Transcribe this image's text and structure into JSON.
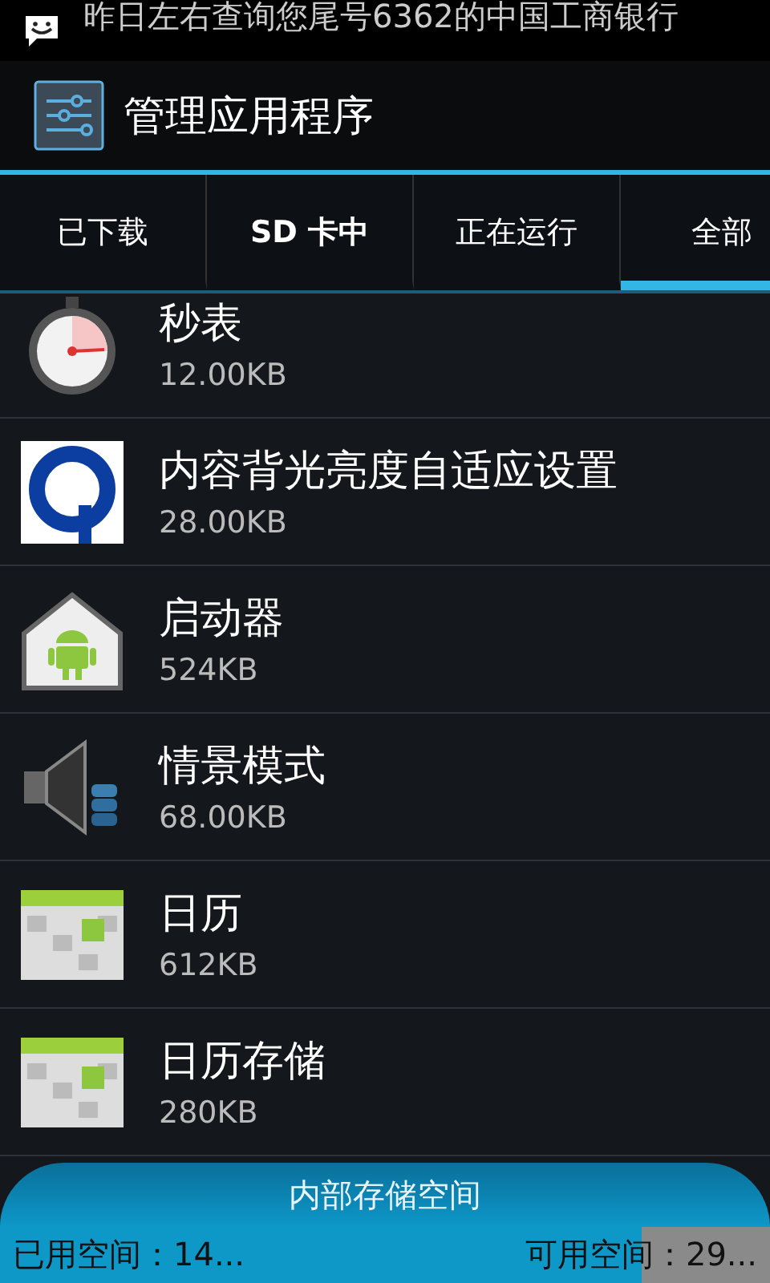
{
  "notification": {
    "text": "昨日左右查询您尾号6362的中国工商银行"
  },
  "app_bar": {
    "title": "管理应用程序"
  },
  "tabs": [
    {
      "label": "已下载",
      "selected": false
    },
    {
      "label": "SD 卡中",
      "selected": false
    },
    {
      "label": "正在运行",
      "selected": false
    },
    {
      "label": "全部",
      "selected": true
    }
  ],
  "apps": [
    {
      "name": "秒表",
      "size": "12.00KB"
    },
    {
      "name": "内容背光亮度自适应设置",
      "size": "28.00KB"
    },
    {
      "name": "启动器",
      "size": "524KB"
    },
    {
      "name": "情景模式",
      "size": "68.00KB"
    },
    {
      "name": "日历",
      "size": "612KB"
    },
    {
      "name": "日历存储",
      "size": "280KB"
    }
  ],
  "storage": {
    "title": "内部存储空间",
    "used": "已用空间：14...",
    "free": "可用空间：29...",
    "level": 0.833
  }
}
